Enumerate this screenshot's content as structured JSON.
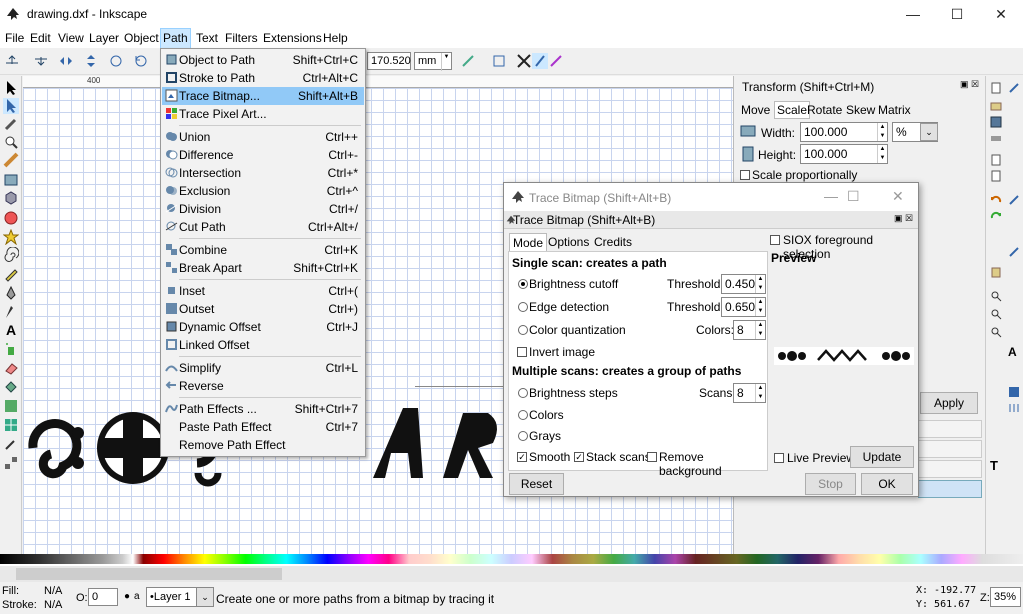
{
  "window": {
    "title": "drawing.dxf - Inkscape",
    "minimize": "—",
    "maximize": "☐",
    "close": "✕"
  },
  "menubar": [
    "File",
    "Edit",
    "View",
    "Layer",
    "Object",
    "Path",
    "Text",
    "Filters",
    "Extensions",
    "Help"
  ],
  "ctrlbar": {
    "value": "170.520",
    "unit": "mm"
  },
  "ruler": {
    "label": "400"
  },
  "path_menu": [
    {
      "label": "Object to Path",
      "shortcut": "Shift+Ctrl+C"
    },
    {
      "label": "Stroke to Path",
      "shortcut": "Ctrl+Alt+C"
    },
    {
      "label": "Trace Bitmap...",
      "shortcut": "Shift+Alt+B"
    },
    {
      "label": "Trace Pixel Art...",
      "shortcut": ""
    },
    {
      "label": "Union",
      "shortcut": "Ctrl++"
    },
    {
      "label": "Difference",
      "shortcut": "Ctrl+-"
    },
    {
      "label": "Intersection",
      "shortcut": "Ctrl+*"
    },
    {
      "label": "Exclusion",
      "shortcut": "Ctrl+^"
    },
    {
      "label": "Division",
      "shortcut": "Ctrl+/"
    },
    {
      "label": "Cut Path",
      "shortcut": "Ctrl+Alt+/"
    },
    {
      "label": "Combine",
      "shortcut": "Ctrl+K"
    },
    {
      "label": "Break Apart",
      "shortcut": "Shift+Ctrl+K"
    },
    {
      "label": "Inset",
      "shortcut": "Ctrl+("
    },
    {
      "label": "Outset",
      "shortcut": "Ctrl+)"
    },
    {
      "label": "Dynamic Offset",
      "shortcut": "Ctrl+J"
    },
    {
      "label": "Linked Offset",
      "shortcut": ""
    },
    {
      "label": "Simplify",
      "shortcut": "Ctrl+L"
    },
    {
      "label": "Reverse",
      "shortcut": ""
    },
    {
      "label": "Path Effects ...",
      "shortcut": "Shift+Ctrl+7"
    },
    {
      "label": "Paste Path Effect",
      "shortcut": "Ctrl+7"
    },
    {
      "label": "Remove Path Effect",
      "shortcut": ""
    }
  ],
  "transform": {
    "title": "Transform (Shift+Ctrl+M)",
    "tabs": [
      "Move",
      "Scale",
      "Rotate",
      "Skew",
      "Matrix"
    ],
    "width_label": "Width:",
    "width_value": "100.000",
    "unit": "%",
    "height_label": "Height:",
    "height_value": "100.000",
    "scale_proportionally": "Scale proportionally",
    "apply": "Apply"
  },
  "trace": {
    "window_title": "Trace Bitmap (Shift+Alt+B)",
    "sub_title": "Trace Bitmap (Shift+Alt+B)",
    "tabs": [
      "Mode",
      "Options",
      "Credits"
    ],
    "single_heading": "Single scan: creates a path",
    "brightness_cutoff": "Brightness cutoff",
    "threshold_label": "Threshold:",
    "threshold_1": "0.450",
    "edge_detection": "Edge detection",
    "threshold_2": "0.650",
    "color_quantization": "Color quantization",
    "colors_label": "Colors:",
    "colors_value": "8",
    "invert_image": "Invert image",
    "multi_heading": "Multiple scans: creates a group of paths",
    "brightness_steps": "Brightness steps",
    "scans_label": "Scans:",
    "scans_value": "8",
    "colors_opt": "Colors",
    "grays_opt": "Grays",
    "smooth": "Smooth",
    "stack_scans": "Stack scans",
    "remove_background": "Remove background",
    "siox": "SIOX foreground selection",
    "preview_label": "Preview",
    "live_preview": "Live Preview",
    "update": "Update",
    "reset": "Reset",
    "stop": "Stop",
    "ok": "OK"
  },
  "status": {
    "fill_label": "Fill:",
    "fill_value": "N/A",
    "stroke_label": "Stroke:",
    "stroke_value": "N/A",
    "opacity_label": "O:",
    "opacity_value": "0",
    "layer": "•Layer 1",
    "message": "Create one or more paths from a bitmap by tracing it",
    "x": "X: -192.77",
    "y": "Y: 561.67",
    "zoom_label": "Z:",
    "zoom": "35%"
  },
  "colors": {
    "accent": "#91c9f7",
    "grid": "#c8d4ee"
  }
}
